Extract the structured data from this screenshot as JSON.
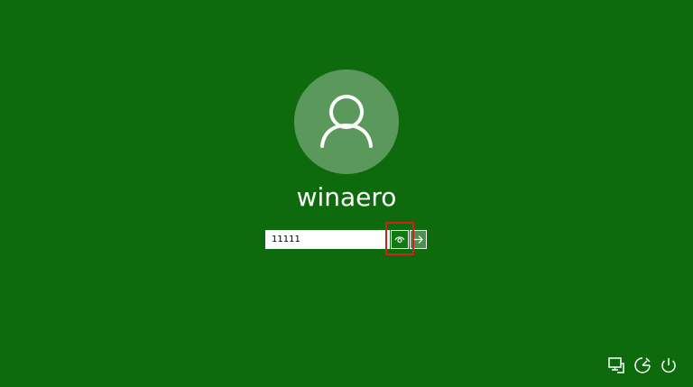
{
  "login": {
    "username": "winaero",
    "password_value": "11111"
  },
  "icons": {
    "avatar": "user-silhouette-icon",
    "reveal": "eye-icon",
    "submit": "arrow-right-icon",
    "network": "network-icon",
    "ease_of_access": "ease-of-access-icon",
    "power": "power-icon"
  },
  "colors": {
    "background": "#0d6b0d",
    "avatar_circle": "#5b985b",
    "reveal_button": "#0f7a0f",
    "submit_button": "#4f8f4f",
    "highlight": "#d12020"
  }
}
